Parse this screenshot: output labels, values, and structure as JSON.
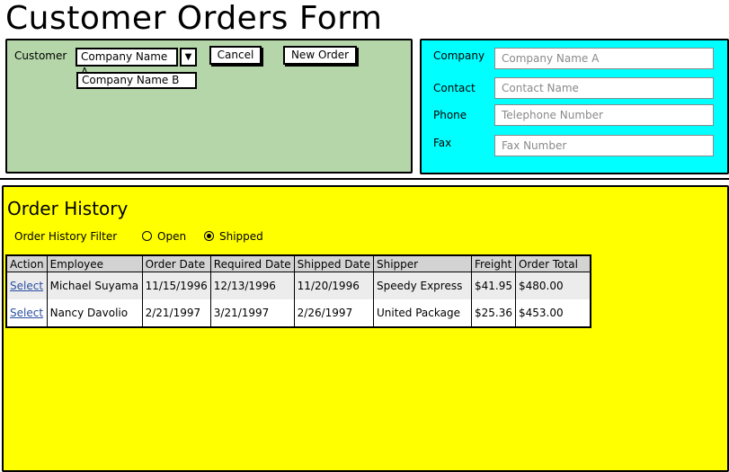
{
  "title": "Customer Orders Form",
  "customer_panel": {
    "label": "Customer",
    "selected": "Company Name A",
    "dropdown_option": "Company Name B",
    "cancel_label": "Cancel",
    "new_order_label": "New Order",
    "bg_color": "#b4d6a9"
  },
  "contact_panel": {
    "bg_color": "#00ffff",
    "fields": [
      {
        "label": "Company",
        "placeholder": "Company Name A"
      },
      {
        "label": "Contact",
        "placeholder": "Contact Name"
      },
      {
        "label": "Phone",
        "placeholder": "Telephone Number"
      },
      {
        "label": "Fax",
        "placeholder": "Fax Number"
      }
    ]
  },
  "history": {
    "title": "Order History",
    "bg_color": "#ffff00",
    "filter_label": "Order History Filter",
    "filter_options": [
      "Open",
      "Shipped"
    ],
    "filter_selected": "Shipped",
    "columns": [
      "Action",
      "Employee",
      "Order Date",
      "Required Date",
      "Shipped Date",
      "Shipper",
      "Freight",
      "Order Total"
    ],
    "rows": [
      {
        "action": "Select",
        "employee": "Michael Suyama",
        "order_date": "11/15/1996",
        "required_date": "12/13/1996",
        "shipped_date": "11/20/1996",
        "shipper": "Speedy Express",
        "freight": "$41.95",
        "order_total": "$480.00"
      },
      {
        "action": "Select",
        "employee": "Nancy Davolio",
        "order_date": "2/21/1997",
        "required_date": "3/21/1997",
        "shipped_date": "2/26/1997",
        "shipper": "United Package",
        "freight": "$25.36",
        "order_total": "$453.00"
      }
    ]
  }
}
